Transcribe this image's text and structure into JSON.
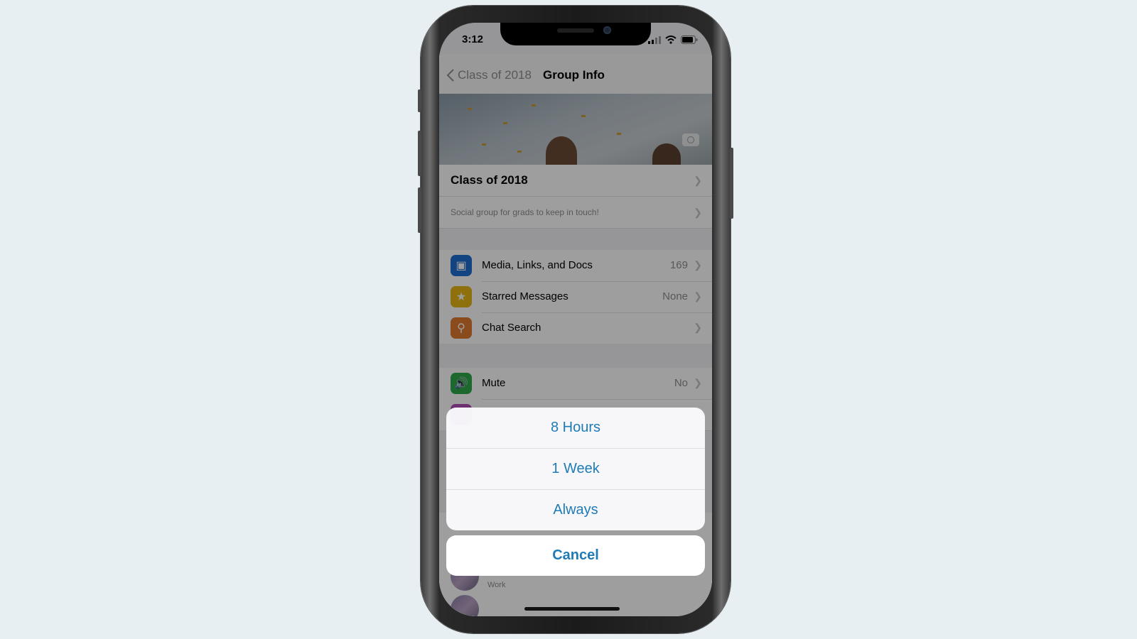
{
  "status_bar": {
    "time": "3:12",
    "icons": [
      "cellular-signal-icon",
      "wifi-icon",
      "battery-icon"
    ]
  },
  "nav": {
    "back_label": "Class of 2018",
    "title": "Group Info"
  },
  "group": {
    "name": "Class of 2018",
    "description": "Social group for grads to keep in touch!"
  },
  "items": [
    {
      "label": "Media, Links, and Docs",
      "value": "169",
      "icon": "photo-icon",
      "color": "#1e6fd0"
    },
    {
      "label": "Starred Messages",
      "value": "None",
      "icon": "star-icon",
      "color": "#e5b614"
    },
    {
      "label": "Chat Search",
      "value": "",
      "icon": "search-icon",
      "color": "#e17b2f"
    }
  ],
  "mute": {
    "label": "Mute",
    "value": "No",
    "icon": "speaker-icon",
    "color": "#2ea84a"
  },
  "partial_rows": [
    {
      "label": "Work"
    }
  ],
  "action_sheet": {
    "options": [
      "8 Hours",
      "1 Week",
      "Always"
    ],
    "cancel_label": "Cancel",
    "accent_color": "#1f7bb5"
  }
}
